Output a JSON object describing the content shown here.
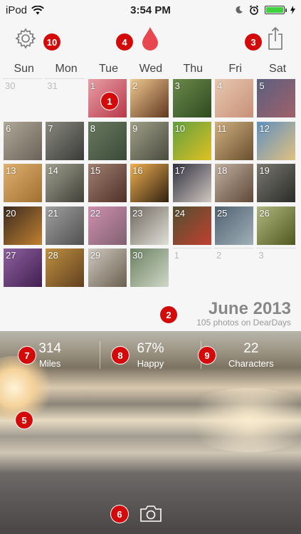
{
  "status_bar": {
    "carrier": "iPod",
    "time": "3:54 PM"
  },
  "weekdays": [
    "Sun",
    "Mon",
    "Tue",
    "Wed",
    "Thu",
    "Fri",
    "Sat"
  ],
  "calendar": [
    {
      "day": "30",
      "other": true
    },
    {
      "day": "31",
      "other": true
    },
    {
      "day": "1",
      "c": [
        "#e8a0a8",
        "#b83848"
      ]
    },
    {
      "day": "2",
      "c": [
        "#f0c890",
        "#603820"
      ]
    },
    {
      "day": "3",
      "c": [
        "#6a8a4a",
        "#2e4a20"
      ]
    },
    {
      "day": "4",
      "c": [
        "#e8c8b0",
        "#c89078"
      ]
    },
    {
      "day": "5",
      "c": [
        "#5a6080",
        "#a0606a"
      ]
    },
    {
      "day": "6",
      "c": [
        "#b0a898",
        "#6a6258"
      ]
    },
    {
      "day": "7",
      "c": [
        "#8a8a80",
        "#3a3a38"
      ]
    },
    {
      "day": "8",
      "c": [
        "#6a7a60",
        "#3a4a38"
      ]
    },
    {
      "day": "9",
      "c": [
        "#a0a088",
        "#4a4a40"
      ]
    },
    {
      "day": "10",
      "c": [
        "#60a040",
        "#e0c020"
      ]
    },
    {
      "day": "11",
      "c": [
        "#d0b080",
        "#6a5030"
      ]
    },
    {
      "day": "12",
      "c": [
        "#6090c0",
        "#e0c080"
      ]
    },
    {
      "day": "13",
      "c": [
        "#e0b070",
        "#a07030"
      ]
    },
    {
      "day": "14",
      "c": [
        "#a0a090",
        "#404038"
      ]
    },
    {
      "day": "15",
      "c": [
        "#a08070",
        "#503028"
      ]
    },
    {
      "day": "16",
      "c": [
        "#f0b050",
        "#302010"
      ]
    },
    {
      "day": "17",
      "c": [
        "#303040",
        "#d0c8c0"
      ]
    },
    {
      "day": "18",
      "c": [
        "#c0b0a0",
        "#604838"
      ]
    },
    {
      "day": "19",
      "c": [
        "#7a7a70",
        "#2a2a28"
      ]
    },
    {
      "day": "20",
      "c": [
        "#3a2a20",
        "#c08030"
      ]
    },
    {
      "day": "21",
      "c": [
        "#a0a0a0",
        "#505050"
      ]
    },
    {
      "day": "22",
      "c": [
        "#d090b0",
        "#806070"
      ]
    },
    {
      "day": "23",
      "c": [
        "#706860",
        "#e0e0d8"
      ]
    },
    {
      "day": "24",
      "c": [
        "#505030",
        "#c04030"
      ]
    },
    {
      "day": "25",
      "c": [
        "#506070",
        "#a0b0b8"
      ]
    },
    {
      "day": "26",
      "c": [
        "#b0b880",
        "#505820"
      ]
    },
    {
      "day": "27",
      "c": [
        "#9060a0",
        "#402050"
      ]
    },
    {
      "day": "28",
      "c": [
        "#c09040",
        "#604020"
      ]
    },
    {
      "day": "29",
      "c": [
        "#d0c8c0",
        "#6a6050"
      ]
    },
    {
      "day": "30",
      "c": [
        "#6a8060",
        "#d0d8c8"
      ]
    },
    {
      "day": "1",
      "other": true
    },
    {
      "day": "2",
      "other": true
    },
    {
      "day": "3",
      "other": true
    }
  ],
  "month": {
    "title": "June 2013",
    "subtitle": "105 photos on DearDays"
  },
  "stats": [
    {
      "value": "314",
      "label": "Miles"
    },
    {
      "value": "67%",
      "label": "Happy"
    },
    {
      "value": "22",
      "label": "Characters"
    }
  ],
  "badges": [
    "1",
    "2",
    "3",
    "4",
    "5",
    "6",
    "7",
    "8",
    "9",
    "10"
  ],
  "colors": {
    "badge": "#d40a0a",
    "drop": "#e8474f",
    "battery": "#3fd13f"
  }
}
